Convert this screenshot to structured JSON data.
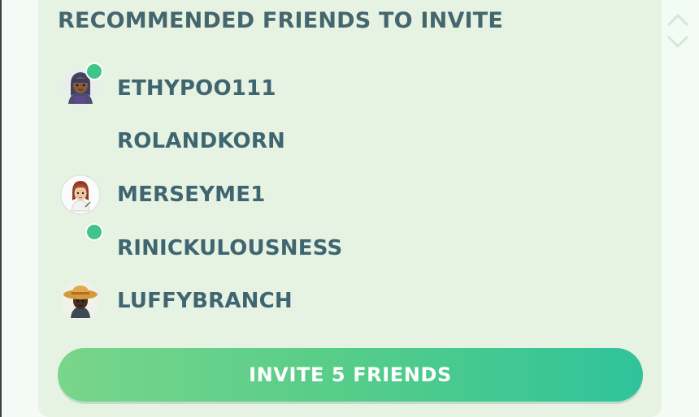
{
  "section": {
    "title": "RECOMMENDED FRIENDS TO INVITE"
  },
  "friends": [
    {
      "name": "ETHYPOO111",
      "online": true,
      "has_avatar": true
    },
    {
      "name": "ROLANDKORN",
      "online": false,
      "has_avatar": false
    },
    {
      "name": "MERSEYME1",
      "online": false,
      "has_avatar": true
    },
    {
      "name": "RINICKULOUSNESS",
      "online": true,
      "has_avatar": false
    },
    {
      "name": "LUFFYBRANCH",
      "online": false,
      "has_avatar": true
    }
  ],
  "invite_button": {
    "label": "INVITE 5 FRIENDS"
  },
  "icons": {
    "scroll_up": "chevron-up-icon",
    "scroll_down": "chevron-down-icon",
    "online_status": "online-dot-icon"
  },
  "colors": {
    "panel_background": "#e6f2e2",
    "text": "#3f6670",
    "online_indicator": "#3fc58a",
    "button_gradient_start": "#79d58a",
    "button_gradient_end": "#30c39b",
    "button_text": "#ffffff"
  }
}
